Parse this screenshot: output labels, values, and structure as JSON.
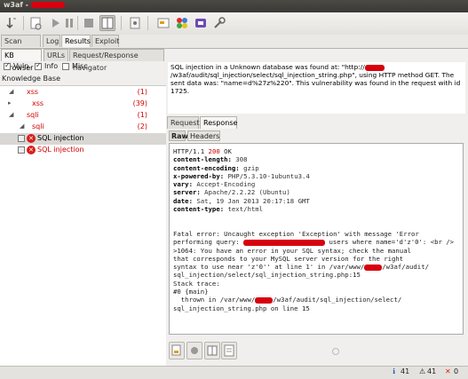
{
  "window": {
    "title": "w3af - "
  },
  "toolbar": {
    "buttons": [
      "start-icon",
      "clear-icon",
      "play-icon",
      "pause-icon",
      "stop-icon",
      "panel-icon",
      "config-icon",
      "toggle-icon",
      "shield-icon",
      "tool-icon",
      "wrench-icon"
    ]
  },
  "main_tabs": [
    "Scan config",
    "Log",
    "Results",
    "Exploit"
  ],
  "sub_tabs": [
    "KB Browser",
    "URLs",
    "Request/Response navigator"
  ],
  "filters": [
    {
      "label": "Vuln",
      "checked": true
    },
    {
      "label": "Info",
      "checked": true
    },
    {
      "label": "Misc",
      "checked": false
    }
  ],
  "kb": {
    "heading": "Knowledge Base",
    "rows": [
      {
        "label": "xss",
        "count": "(1)"
      },
      {
        "label": "xss",
        "count": "(39)"
      },
      {
        "label": "sqli",
        "count": "(1)"
      },
      {
        "label": "sqli",
        "count": "(2)"
      },
      {
        "label": "SQL injection",
        "count": ""
      },
      {
        "label": "SQL injection",
        "count": ""
      }
    ]
  },
  "description": {
    "part1": "SQL injection in a Unknown database was found at: \"http://",
    "part2": "/w3af/audit/sql_injection/select/sql_injection_string.php\", using HTTP method GET. The sent data was: \"name=d%27z%220\". This vulnerability was found in the request with id 1725."
  },
  "reqresp_tabs": [
    "Request",
    "Response"
  ],
  "view_tabs": [
    "Raw",
    "Headers"
  ],
  "response": {
    "status_prefix": "HTTP/1.1 ",
    "status_code": "200",
    "status_suffix": " OK",
    "headers": [
      {
        "k": "content-length:",
        "v": " 308"
      },
      {
        "k": "content-encoding:",
        "v": " gzip"
      },
      {
        "k": "x-powered-by:",
        "v": " PHP/5.3.10-1ubuntu3.4"
      },
      {
        "k": "vary:",
        "v": " Accept-Encoding"
      },
      {
        "k": "server:",
        "v": " Apache/2.2.22 (Ubuntu)"
      },
      {
        "k": "date:",
        "v": " Sat, 19 Jan 2013 20:17:18 GMT"
      },
      {
        "k": "content-type:",
        "v": " text/html"
      }
    ],
    "body1": "Fatal error: Uncaught exception 'Exception' with message 'Error",
    "body2a": "performing query: ",
    "body2b": " users where name='d'z'0': <br />",
    "body3": ">1064: You have an error in your SQL syntax; check the manual",
    "body4": "that corresponds to your MySQL server version for the right",
    "body5a": "syntax to use near 'z'0'' at line 1' in /var/www/",
    "body5b": "/w3af/audit/",
    "body6": "sql_injection/select/sql_injection_string.php:15",
    "body7": "Stack trace:",
    "body8": "#0 {main}",
    "body9a": "  thrown in /var/www/",
    "body9b": "/w3af/audit/sql_injection/select/",
    "body10": "sql_injection_string.php on line 15"
  },
  "status": {
    "a": "41",
    "b": "41",
    "c": "0"
  }
}
